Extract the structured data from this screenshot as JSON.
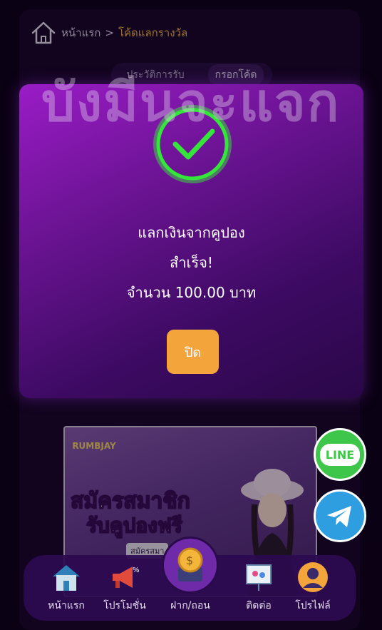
{
  "breadcrumb": {
    "home": "หน้าแรก",
    "separator": ">",
    "current": "โค้ดแลกรางวัล"
  },
  "tabs": [
    {
      "label": "ประวัติการรับ"
    },
    {
      "label": "กรอกโค้ด"
    }
  ],
  "watermark": "บังมีนจะแจก",
  "modal": {
    "line1": "แลกเงินจากคูปอง",
    "line2": "สำเร็จ!",
    "line3": "จำนวน 100.00 บาท",
    "close_label": "ปิด"
  },
  "promo": {
    "logo": "RUMBJAY",
    "title_part1": "สมัคร",
    "title_part2": "สมาชิก",
    "title_line2": "รับคูปองฟรี",
    "sub": "สมัครสมา"
  },
  "floating": {
    "line_label": "LINE"
  },
  "nav": [
    {
      "label": "หน้าแรก"
    },
    {
      "label": "โปรโมชั่น"
    },
    {
      "label": "ฝาก/ถอน"
    },
    {
      "label": "ติดต่อ"
    },
    {
      "label": "โปรไฟล์"
    }
  ],
  "colors": {
    "accent": "#f3a43a",
    "success": "#35e63a",
    "modal_top": "#9a1cc6",
    "modal_bottom": "#2a0748"
  }
}
